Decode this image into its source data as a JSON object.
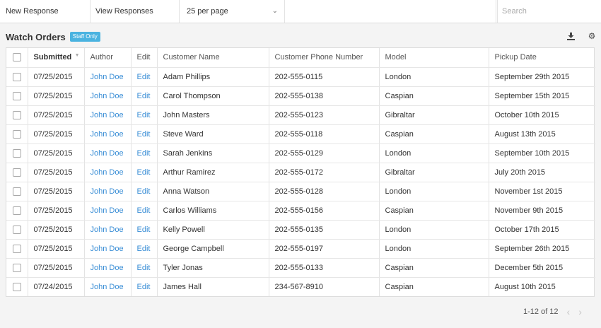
{
  "toolbar": {
    "new_response": "New Response",
    "view_responses": "View Responses",
    "per_page": "25 per page",
    "search_placeholder": "Search"
  },
  "header": {
    "title": "Watch Orders",
    "badge": "Staff Only",
    "download_icon": "download-icon",
    "settings_icon": "gear-icon"
  },
  "table": {
    "columns": [
      "Submitted",
      "Author",
      "Edit",
      "Customer Name",
      "Customer Phone Number",
      "Model",
      "Pickup Date"
    ],
    "rows": [
      {
        "submitted": "07/25/2015",
        "author": "John Doe",
        "edit": "Edit",
        "name": "Adam Phillips",
        "phone": "202-555-0115",
        "model": "London",
        "pickup": "September 29th 2015"
      },
      {
        "submitted": "07/25/2015",
        "author": "John Doe",
        "edit": "Edit",
        "name": "Carol Thompson",
        "phone": "202-555-0138",
        "model": "Caspian",
        "pickup": "September 15th 2015"
      },
      {
        "submitted": "07/25/2015",
        "author": "John Doe",
        "edit": "Edit",
        "name": "John Masters",
        "phone": "202-555-0123",
        "model": "Gibraltar",
        "pickup": "October 10th 2015"
      },
      {
        "submitted": "07/25/2015",
        "author": "John Doe",
        "edit": "Edit",
        "name": "Steve Ward",
        "phone": "202-555-0118",
        "model": "Caspian",
        "pickup": "August 13th 2015"
      },
      {
        "submitted": "07/25/2015",
        "author": "John Doe",
        "edit": "Edit",
        "name": "Sarah Jenkins",
        "phone": "202-555-0129",
        "model": "London",
        "pickup": "September 10th 2015"
      },
      {
        "submitted": "07/25/2015",
        "author": "John Doe",
        "edit": "Edit",
        "name": "Arthur Ramirez",
        "phone": "202-555-0172",
        "model": "Gibraltar",
        "pickup": "July 20th 2015"
      },
      {
        "submitted": "07/25/2015",
        "author": "John Doe",
        "edit": "Edit",
        "name": "Anna Watson",
        "phone": "202-555-0128",
        "model": "London",
        "pickup": "November 1st 2015"
      },
      {
        "submitted": "07/25/2015",
        "author": "John Doe",
        "edit": "Edit",
        "name": "Carlos Williams",
        "phone": "202-555-0156",
        "model": "Caspian",
        "pickup": "November 9th 2015"
      },
      {
        "submitted": "07/25/2015",
        "author": "John Doe",
        "edit": "Edit",
        "name": "Kelly Powell",
        "phone": "202-555-0135",
        "model": "London",
        "pickup": "October 17th 2015"
      },
      {
        "submitted": "07/25/2015",
        "author": "John Doe",
        "edit": "Edit",
        "name": "George Campbell",
        "phone": "202-555-0197",
        "model": "London",
        "pickup": "September 26th 2015"
      },
      {
        "submitted": "07/25/2015",
        "author": "John Doe",
        "edit": "Edit",
        "name": "Tyler Jonas",
        "phone": "202-555-0133",
        "model": "Caspian",
        "pickup": "December 5th 2015"
      },
      {
        "submitted": "07/24/2015",
        "author": "John Doe",
        "edit": "Edit",
        "name": "James Hall",
        "phone": "234-567-8910",
        "model": "Caspian",
        "pickup": "August 10th 2015"
      }
    ]
  },
  "pager": {
    "summary": "1-12 of 12",
    "prev_icon": "chevron-left-icon",
    "next_icon": "chevron-right-icon"
  },
  "colors": {
    "link": "#3a8ed6",
    "badge": "#4ab3e0"
  }
}
